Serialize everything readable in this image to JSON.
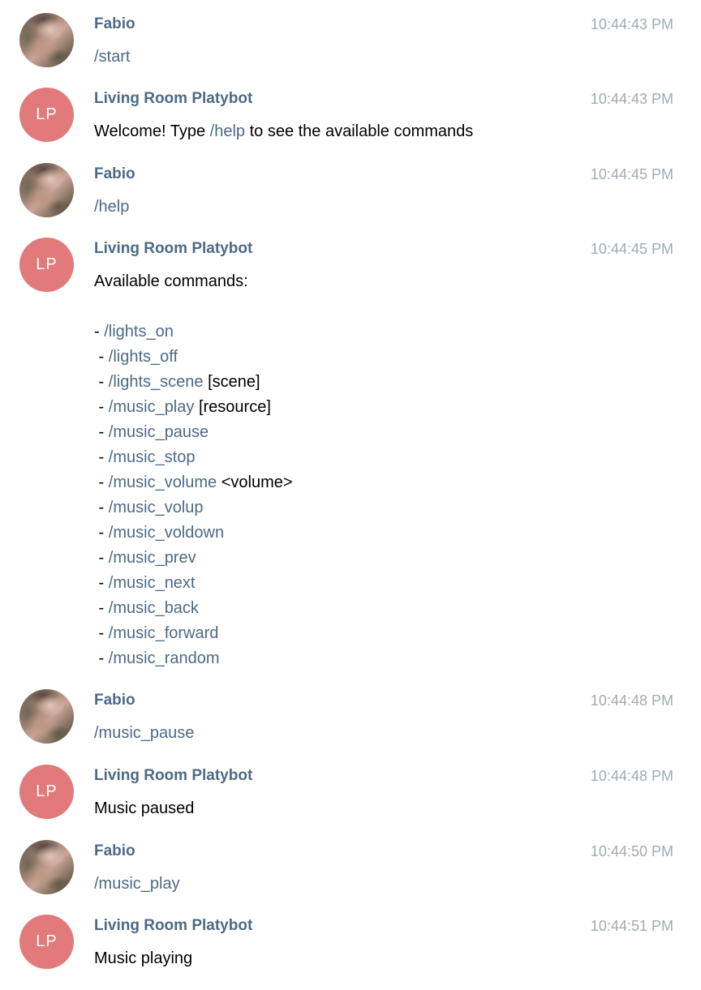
{
  "colors": {
    "sender": "#4d6a86",
    "command": "#4d6a86",
    "timestamp": "#a2aab3",
    "bot_avatar": "#e27a7c",
    "text": "#000000"
  },
  "messages": [
    {
      "sender": "Fabio",
      "time": "10:44:43 PM",
      "text": "/start"
    },
    {
      "sender": "Living Room Platybot",
      "avatar_initials": "LP",
      "time": "10:44:43 PM",
      "text_before": "Welcome! Type ",
      "command": "/help",
      "text_after": " to see the available commands"
    },
    {
      "sender": "Fabio",
      "time": "10:44:45 PM",
      "text": "/help"
    },
    {
      "sender": "Living Room Platybot",
      "avatar_initials": "LP",
      "time": "10:44:45 PM",
      "text": "Available commands:",
      "commands": [
        {
          "prefix": "- ",
          "command": "/lights_on",
          "arg": ""
        },
        {
          "prefix": " - ",
          "command": "/lights_off",
          "arg": ""
        },
        {
          "prefix": " - ",
          "command": "/lights_scene",
          "arg": " [scene]"
        },
        {
          "prefix": " - ",
          "command": "/music_play",
          "arg": " [resource]"
        },
        {
          "prefix": " - ",
          "command": "/music_pause",
          "arg": ""
        },
        {
          "prefix": " - ",
          "command": "/music_stop",
          "arg": ""
        },
        {
          "prefix": " - ",
          "command": "/music_volume",
          "arg": " <volume>"
        },
        {
          "prefix": " - ",
          "command": "/music_volup",
          "arg": ""
        },
        {
          "prefix": " - ",
          "command": "/music_voldown",
          "arg": ""
        },
        {
          "prefix": " - ",
          "command": "/music_prev",
          "arg": ""
        },
        {
          "prefix": " - ",
          "command": "/music_next",
          "arg": ""
        },
        {
          "prefix": " - ",
          "command": "/music_back",
          "arg": ""
        },
        {
          "prefix": " - ",
          "command": "/music_forward",
          "arg": ""
        },
        {
          "prefix": " - ",
          "command": "/music_random",
          "arg": ""
        }
      ]
    },
    {
      "sender": "Fabio",
      "time": "10:44:48 PM",
      "text": "/music_pause"
    },
    {
      "sender": "Living Room Platybot",
      "avatar_initials": "LP",
      "time": "10:44:48 PM",
      "text": "Music paused"
    },
    {
      "sender": "Fabio",
      "time": "10:44:50 PM",
      "text": "/music_play"
    },
    {
      "sender": "Living Room Platybot",
      "avatar_initials": "LP",
      "time": "10:44:51 PM",
      "text": "Music playing"
    }
  ]
}
